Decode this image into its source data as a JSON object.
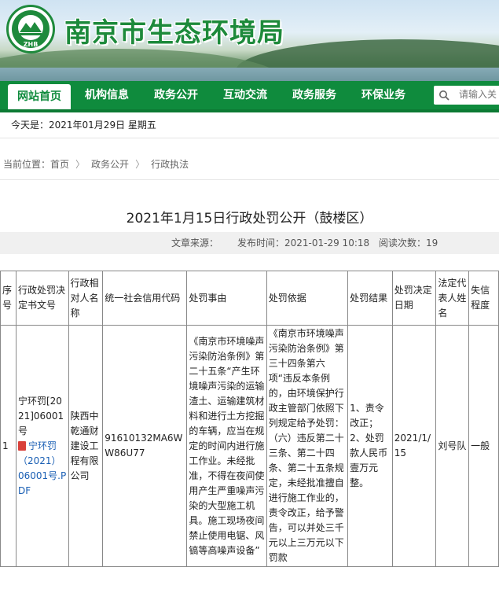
{
  "header": {
    "site_title": "南京市生态环境局",
    "logo_text": "ZHB"
  },
  "nav": {
    "items": [
      "网站首页",
      "机构信息",
      "政务公开",
      "互动交流",
      "政务服务",
      "环保业务"
    ],
    "search_placeholder": "请输入关"
  },
  "datebar": {
    "text": "今天是：2021年01月29日 星期五"
  },
  "breadcrumb": {
    "label": "当前位置：",
    "items": [
      "首页",
      "政务公开",
      "行政执法"
    ],
    "separator": "〉"
  },
  "article": {
    "title": "2021年1月15日行政处罚公开（鼓楼区）",
    "source_label": "文章来源：",
    "date_label": "发布时间：2021-01-29 10:18",
    "views_label": "阅读次数：19"
  },
  "table": {
    "headers": [
      "序号",
      "行政处罚决定书文号",
      "行政相对人名称",
      "统一社会信用代码",
      "处罚事由",
      "处罚依据",
      "处罚结果",
      "处罚决定日期",
      "法定代表人姓名",
      "失信程度"
    ],
    "rows": [
      {
        "index": "1",
        "doc_no": "宁环罚[2021]06001号",
        "pdf_link": "宁环罚（2021）06001号.PDF",
        "party": "陕西中乾通财建设工程有限公司",
        "credit_code": "91610132MA6WW86U77",
        "reason": "《南京市环境噪声污染防治条例》第二十五条“产生环境噪声污染的运输渣土、运输建筑材料和进行土方挖掘的车辆，应当在规定的时间内进行施工作业。未经批准，不得在夜间使用产生严重噪声污染的大型施工机具。施工现场夜间禁止使用电锯、风镐等高噪声设备”",
        "basis": "《南京市环境噪声污染防治条例》第三十四条第六项“违反本条例的，由环境保护行政主管部门依照下列规定给予处罚：（六）违反第二十三条、第二十四条、第二十五条规定，未经批准擅自进行施工作业的，责令改正，给予警告，可以并处三千元以上三万元以下罚款",
        "result": "1、责令改正；2、处罚款人民币壹万元整。",
        "date": "2021/1/15",
        "legal_rep": "刘号队",
        "severity": "一般"
      }
    ]
  },
  "colors": {
    "brand_green": "#0f8b3d",
    "title_green": "#1d8a3b",
    "link_blue": "#1a5fb4"
  }
}
